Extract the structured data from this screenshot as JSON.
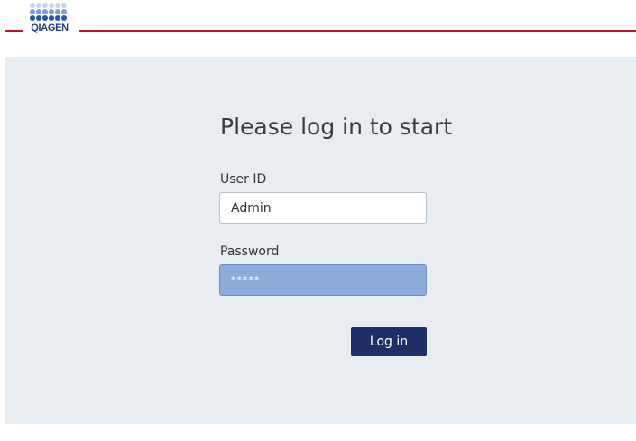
{
  "brand": {
    "logo_text": "QIAGEN",
    "accent_color": "#c8102e",
    "logo_color": "#1f3a93"
  },
  "login": {
    "title": "Please log in to start",
    "user_id_label": "User ID",
    "user_id_value": "Admin",
    "password_label": "Password",
    "password_value": "*****",
    "submit_label": "Log in"
  }
}
